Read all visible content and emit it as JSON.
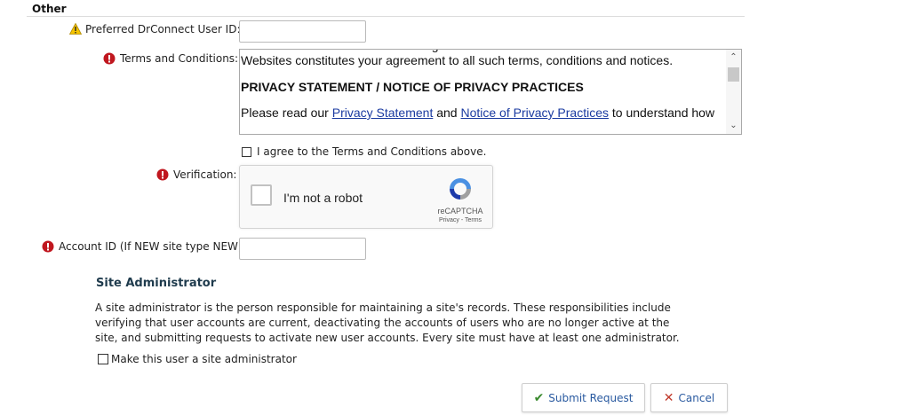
{
  "section": {
    "title": "Other"
  },
  "fields": {
    "drconnect_id": {
      "label": "Preferred DrConnect User ID:",
      "value": "",
      "placeholder": ""
    },
    "terms": {
      "label": "Terms and Conditions:",
      "paragraph1": "these terms and conditions on a regular basis. Your use and continued use of the Websites constitutes your agreement to all such terms, conditions and notices.",
      "heading": "PRIVACY STATEMENT / NOTICE OF PRIVACY PRACTICES",
      "p2_prefix": "Please read our ",
      "p2_link1": "Privacy Statement",
      "p2_mid": " and ",
      "p2_link2": "Notice of Privacy Practices",
      "p2_suffix": " to understand how"
    },
    "agree": {
      "label": "I agree to the Terms and Conditions above.",
      "checked": false
    },
    "verification": {
      "label": "Verification:",
      "captcha_text": "I'm not a robot",
      "brand": "reCAPTCHA",
      "links": "Privacy - Terms"
    },
    "account_id": {
      "label": "Account ID (If NEW site type NEW):",
      "value": "",
      "placeholder": ""
    }
  },
  "site_admin": {
    "title": "Site Administrator",
    "description": "A site administrator is the person responsible for maintaining a site's records. These responsibilities include verifying that user accounts are current, deactivating the accounts of users who are no longer active at the site, and submitting requests to activate new user accounts. Every site must have at least one administrator.",
    "checkbox_label": "Make this user a site administrator",
    "checked": false
  },
  "buttons": {
    "submit": "Submit Request",
    "cancel": "Cancel"
  },
  "icons": {
    "warning": "warning-icon",
    "required": "required-icon",
    "check": "check-icon",
    "close": "close-icon"
  },
  "colors": {
    "warning_yellow": "#f5c400",
    "required_red": "#c0171f",
    "link_blue": "#1a3aa0",
    "heading_dark": "#1f3b4d",
    "submit_green": "#3a8a2e",
    "cancel_red": "#c0392b"
  }
}
